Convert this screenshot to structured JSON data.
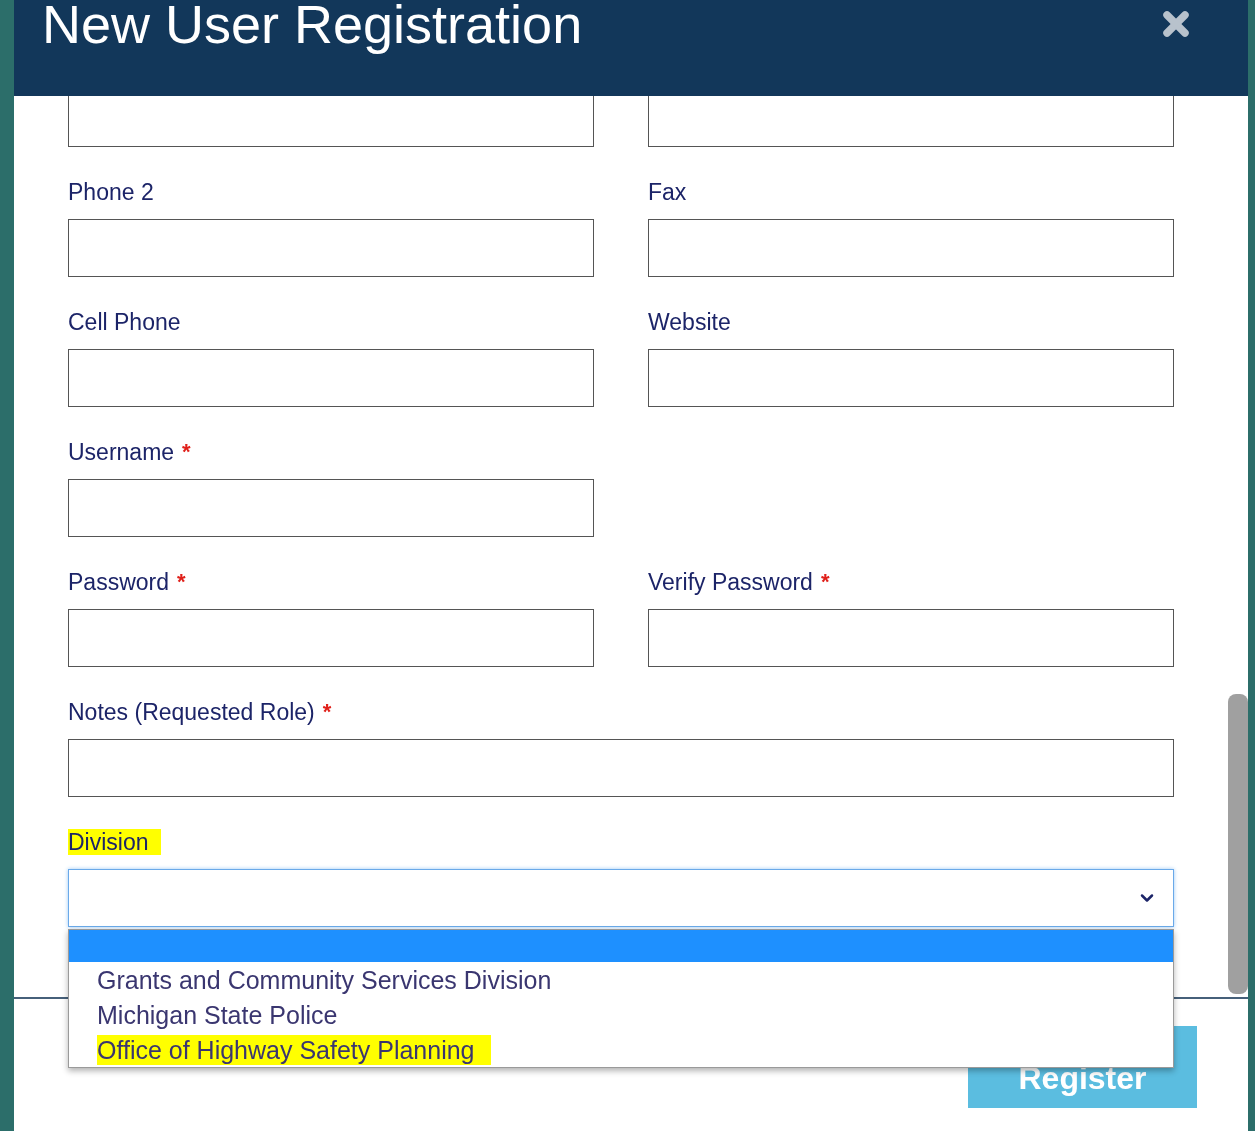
{
  "dialog": {
    "title": "New User Registration"
  },
  "rows": [
    {
      "fields": [
        {
          "kind": "text"
        },
        {
          "kind": "text"
        }
      ]
    },
    {
      "fields": [
        {
          "kind": "text",
          "label": "Phone 2",
          "highlighted": false
        },
        {
          "kind": "text",
          "label": "Fax",
          "highlighted": false
        }
      ]
    },
    {
      "fields": [
        {
          "kind": "text",
          "label": "Cell Phone",
          "highlighted": false
        },
        {
          "kind": "text",
          "label": "Website",
          "highlighted": false
        }
      ]
    },
    {
      "fields": [
        {
          "kind": "text",
          "label": "Username",
          "required_mark": "*",
          "highlighted": false
        }
      ]
    },
    {
      "fields": [
        {
          "kind": "text",
          "label": "Password",
          "required_mark": "*",
          "highlighted": false
        },
        {
          "kind": "text",
          "label": "Verify Password",
          "required_mark": "*",
          "highlighted": false
        }
      ]
    },
    {
      "fields": [
        {
          "kind": "wide",
          "label": "Notes (Requested Role)",
          "required_mark": "*",
          "highlighted": false
        }
      ]
    },
    {
      "fields": [
        {
          "kind": "select",
          "label": "Division",
          "highlighted": true,
          "options": [
            {
              "selected": true
            },
            {
              "label": "Grants and Community Services Division",
              "selected": false,
              "highlighted": false
            },
            {
              "label": "Michigan State Police",
              "selected": false,
              "highlighted": false
            },
            {
              "label": "Office of Highway Safety Planning",
              "selected": false,
              "highlighted": true
            }
          ]
        }
      ]
    }
  ],
  "footer": {
    "button": "Register"
  }
}
